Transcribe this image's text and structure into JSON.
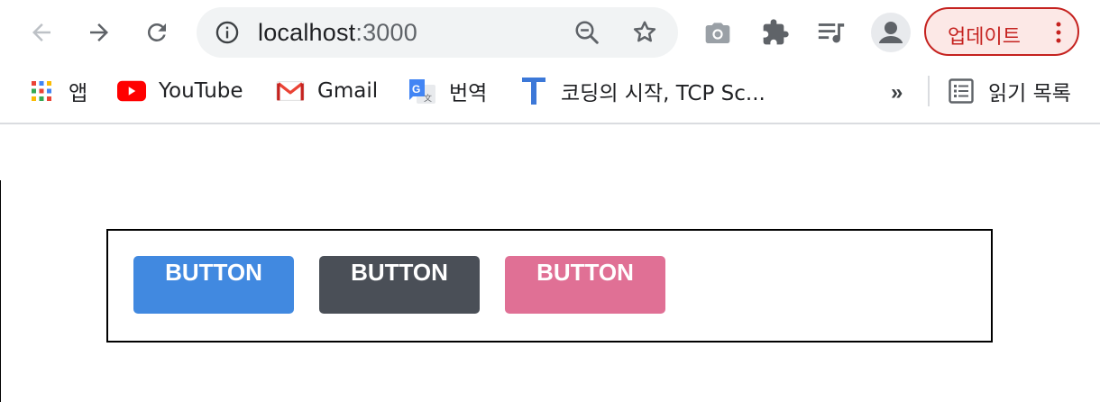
{
  "toolbar": {
    "back_icon": "back-arrow-icon",
    "forward_icon": "forward-arrow-icon",
    "reload_icon": "reload-icon",
    "address": {
      "host": "localhost",
      "port": ":3000"
    },
    "update_label": "업데이트",
    "accent_color": "#c5221f"
  },
  "bookmarks": {
    "items": [
      {
        "label": "앱",
        "icon": "apps-grid-icon"
      },
      {
        "label": "YouTube",
        "icon": "youtube-icon"
      },
      {
        "label": "Gmail",
        "icon": "gmail-icon"
      },
      {
        "label": "번역",
        "icon": "google-translate-icon"
      },
      {
        "label": "코딩의 시작, TCP Sc...",
        "icon": "tcp-school-icon"
      }
    ],
    "more_label": "»",
    "reading_list_label": "읽기 목록"
  },
  "content": {
    "buttons": [
      {
        "label": "BUTTON",
        "color": "#4189e0"
      },
      {
        "label": "BUTTON",
        "color": "#4a4f57"
      },
      {
        "label": "BUTTON",
        "color": "#e07095"
      }
    ]
  }
}
